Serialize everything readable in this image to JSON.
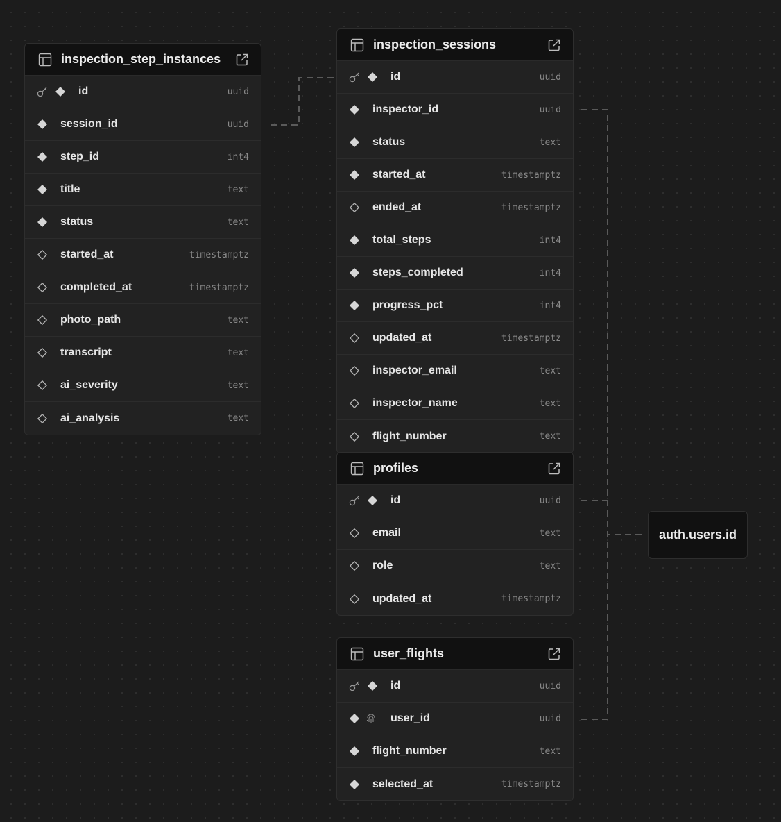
{
  "tables": [
    {
      "key": "inspection_step_instances",
      "name": "inspection_step_instances",
      "columns": [
        {
          "name": "id",
          "type": "uuid",
          "primary": true,
          "nullable": false
        },
        {
          "name": "session_id",
          "type": "uuid",
          "primary": false,
          "nullable": false
        },
        {
          "name": "step_id",
          "type": "int4",
          "primary": false,
          "nullable": false
        },
        {
          "name": "title",
          "type": "text",
          "primary": false,
          "nullable": false
        },
        {
          "name": "status",
          "type": "text",
          "primary": false,
          "nullable": false
        },
        {
          "name": "started_at",
          "type": "timestamptz",
          "primary": false,
          "nullable": true
        },
        {
          "name": "completed_at",
          "type": "timestamptz",
          "primary": false,
          "nullable": true
        },
        {
          "name": "photo_path",
          "type": "text",
          "primary": false,
          "nullable": true
        },
        {
          "name": "transcript",
          "type": "text",
          "primary": false,
          "nullable": true
        },
        {
          "name": "ai_severity",
          "type": "text",
          "primary": false,
          "nullable": true
        },
        {
          "name": "ai_analysis",
          "type": "text",
          "primary": false,
          "nullable": true
        }
      ]
    },
    {
      "key": "inspection_sessions",
      "name": "inspection_sessions",
      "columns": [
        {
          "name": "id",
          "type": "uuid",
          "primary": true,
          "nullable": false
        },
        {
          "name": "inspector_id",
          "type": "uuid",
          "primary": false,
          "nullable": false
        },
        {
          "name": "status",
          "type": "text",
          "primary": false,
          "nullable": false
        },
        {
          "name": "started_at",
          "type": "timestamptz",
          "primary": false,
          "nullable": false
        },
        {
          "name": "ended_at",
          "type": "timestamptz",
          "primary": false,
          "nullable": true
        },
        {
          "name": "total_steps",
          "type": "int4",
          "primary": false,
          "nullable": false
        },
        {
          "name": "steps_completed",
          "type": "int4",
          "primary": false,
          "nullable": false
        },
        {
          "name": "progress_pct",
          "type": "int4",
          "primary": false,
          "nullable": false
        },
        {
          "name": "updated_at",
          "type": "timestamptz",
          "primary": false,
          "nullable": true
        },
        {
          "name": "inspector_email",
          "type": "text",
          "primary": false,
          "nullable": true
        },
        {
          "name": "inspector_name",
          "type": "text",
          "primary": false,
          "nullable": true
        },
        {
          "name": "flight_number",
          "type": "text",
          "primary": false,
          "nullable": true
        }
      ]
    },
    {
      "key": "profiles",
      "name": "profiles",
      "columns": [
        {
          "name": "id",
          "type": "uuid",
          "primary": true,
          "nullable": false
        },
        {
          "name": "email",
          "type": "text",
          "primary": false,
          "nullable": true
        },
        {
          "name": "role",
          "type": "text",
          "primary": false,
          "nullable": true
        },
        {
          "name": "updated_at",
          "type": "timestamptz",
          "primary": false,
          "nullable": true
        }
      ]
    },
    {
      "key": "user_flights",
      "name": "user_flights",
      "columns": [
        {
          "name": "id",
          "type": "uuid",
          "primary": true,
          "nullable": false
        },
        {
          "name": "user_id",
          "type": "uuid",
          "primary": false,
          "nullable": false,
          "unique": true
        },
        {
          "name": "flight_number",
          "type": "text",
          "primary": false,
          "nullable": false
        },
        {
          "name": "selected_at",
          "type": "timestamptz",
          "primary": false,
          "nullable": false
        }
      ]
    }
  ],
  "reference_node": {
    "label": "auth.users.id"
  },
  "relationships": [
    {
      "from": "inspection_step_instances.session_id",
      "to": "inspection_sessions.id"
    },
    {
      "from": "inspection_sessions.inspector_id",
      "to": "auth.users.id"
    },
    {
      "from": "profiles.id",
      "to": "auth.users.id"
    },
    {
      "from": "user_flights.user_id",
      "to": "auth.users.id"
    }
  ],
  "icons": {
    "table": "table-icon",
    "open": "external-link-icon",
    "primary_key": "key-icon",
    "not_null": "filled-diamond-icon",
    "nullable": "hollow-diamond-icon",
    "unique": "fingerprint-icon"
  },
  "colors": {
    "background": "#1c1c1c",
    "card": "#222222",
    "header": "#111111",
    "edge": "#5a5a5a"
  }
}
